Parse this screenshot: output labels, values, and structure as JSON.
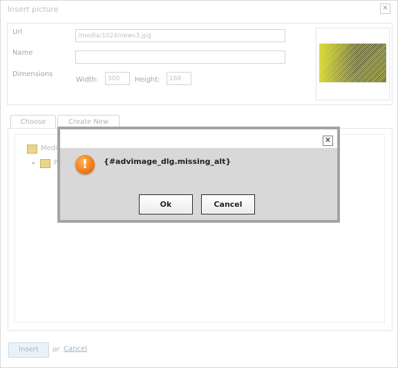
{
  "dialog": {
    "title": "Insert picture",
    "close_glyph": "×",
    "form": {
      "url_label": "Url",
      "url_value": "/media/1024/news3.jpg",
      "name_label": "Name",
      "name_value": "",
      "dimensions_label": "Dimensions",
      "width_label": "Width:",
      "width_value": "300",
      "height_label": "Height:",
      "height_value": "168"
    },
    "tabs": [
      {
        "label": "Choose"
      },
      {
        "label": "Create New"
      }
    ],
    "tree": {
      "root_label": "Media",
      "child_label": "P"
    },
    "footer": {
      "insert_label": "Insert",
      "or_text": "or",
      "cancel_label": "Cancel"
    }
  },
  "alert": {
    "message": "{#advimage_dlg.missing_alt}",
    "close_glyph": "✕",
    "icon": "warning-icon",
    "ok_label": "Ok",
    "cancel_label": "Cancel"
  }
}
